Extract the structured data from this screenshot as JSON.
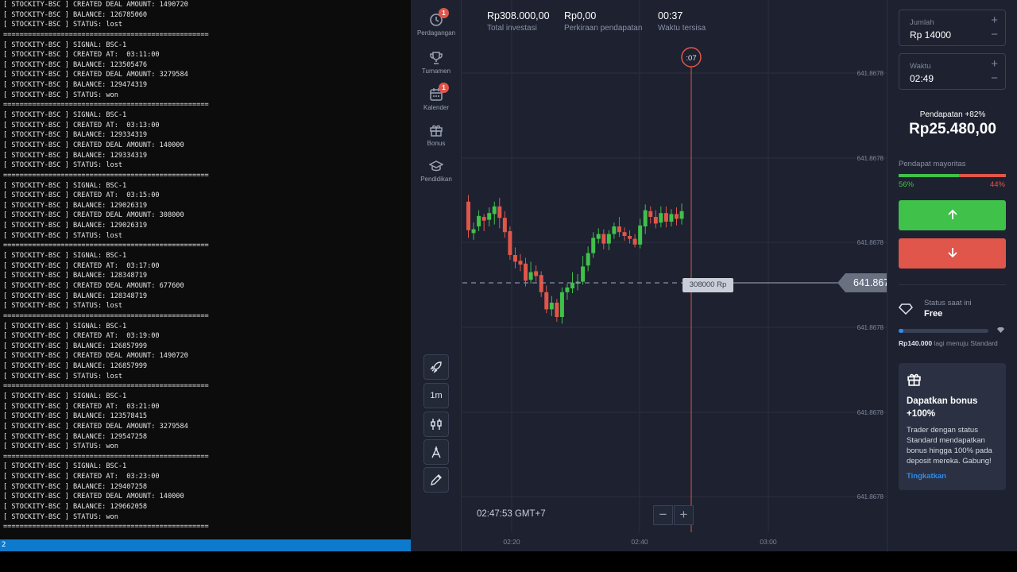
{
  "terminal": {
    "lines": [
      "[ STOCKITY-BSC ] CREATED DEAL AMOUNT: 1490720",
      "[ STOCKITY-BSC ] BALANCE: 126785060",
      "[ STOCKITY-BSC ] STATUS: lost",
      "==================================================",
      "[ STOCKITY-BSC ] SIGNAL: BSC-1",
      "[ STOCKITY-BSC ] CREATED AT:  03:11:00",
      "[ STOCKITY-BSC ] BALANCE: 123505476",
      "[ STOCKITY-BSC ] CREATED DEAL AMOUNT: 3279584",
      "[ STOCKITY-BSC ] BALANCE: 129474319",
      "[ STOCKITY-BSC ] STATUS: won",
      "==================================================",
      "[ STOCKITY-BSC ] SIGNAL: BSC-1",
      "[ STOCKITY-BSC ] CREATED AT:  03:13:00",
      "[ STOCKITY-BSC ] BALANCE: 129334319",
      "[ STOCKITY-BSC ] CREATED DEAL AMOUNT: 140000",
      "[ STOCKITY-BSC ] BALANCE: 129334319",
      "[ STOCKITY-BSC ] STATUS: lost",
      "==================================================",
      "[ STOCKITY-BSC ] SIGNAL: BSC-1",
      "[ STOCKITY-BSC ] CREATED AT:  03:15:00",
      "[ STOCKITY-BSC ] BALANCE: 129026319",
      "[ STOCKITY-BSC ] CREATED DEAL AMOUNT: 308000",
      "[ STOCKITY-BSC ] BALANCE: 129026319",
      "[ STOCKITY-BSC ] STATUS: lost",
      "==================================================",
      "[ STOCKITY-BSC ] SIGNAL: BSC-1",
      "[ STOCKITY-BSC ] CREATED AT:  03:17:00",
      "[ STOCKITY-BSC ] BALANCE: 128348719",
      "[ STOCKITY-BSC ] CREATED DEAL AMOUNT: 677600",
      "[ STOCKITY-BSC ] BALANCE: 128348719",
      "[ STOCKITY-BSC ] STATUS: lost",
      "==================================================",
      "[ STOCKITY-BSC ] SIGNAL: BSC-1",
      "[ STOCKITY-BSC ] CREATED AT:  03:19:00",
      "[ STOCKITY-BSC ] BALANCE: 126857999",
      "[ STOCKITY-BSC ] CREATED DEAL AMOUNT: 1490720",
      "[ STOCKITY-BSC ] BALANCE: 126857999",
      "[ STOCKITY-BSC ] STATUS: lost",
      "==================================================",
      "[ STOCKITY-BSC ] SIGNAL: BSC-1",
      "[ STOCKITY-BSC ] CREATED AT:  03:21:00",
      "[ STOCKITY-BSC ] BALANCE: 123578415",
      "[ STOCKITY-BSC ] CREATED DEAL AMOUNT: 3279584",
      "[ STOCKITY-BSC ] BALANCE: 129547258",
      "[ STOCKITY-BSC ] STATUS: won",
      "==================================================",
      "[ STOCKITY-BSC ] SIGNAL: BSC-1",
      "[ STOCKITY-BSC ] CREATED AT:  03:23:00",
      "[ STOCKITY-BSC ] BALANCE: 129407258",
      "[ STOCKITY-BSC ] CREATED DEAL AMOUNT: 140000",
      "[ STOCKITY-BSC ] BALANCE: 129662058",
      "[ STOCKITY-BSC ] STATUS: won",
      "=================================================="
    ],
    "status_bar_text": "2"
  },
  "sidebar": {
    "items": [
      {
        "label": "Perdagangan",
        "icon": "clock-icon",
        "badge": "1"
      },
      {
        "label": "Turnamen",
        "icon": "trophy-icon",
        "badge": ""
      },
      {
        "label": "Kalender",
        "icon": "calendar-icon",
        "badge": "1"
      },
      {
        "label": "Bonus",
        "icon": "gift-icon",
        "badge": ""
      },
      {
        "label": "Pendidikan",
        "icon": "graduation-cap-icon",
        "badge": ""
      }
    ],
    "tools": [
      {
        "name": "rocket-icon",
        "label": ""
      },
      {
        "name": "timeframe-button",
        "label": "1m"
      },
      {
        "name": "indicators-icon",
        "label": ""
      },
      {
        "name": "drawing-compass-icon",
        "label": ""
      },
      {
        "name": "pencil-icon",
        "label": ""
      }
    ]
  },
  "header": {
    "total_investment": {
      "value": "Rp308.000,00",
      "label": "Total investasi"
    },
    "estimated_income": {
      "value": "Rp0,00",
      "label": "Perkiraan pendapatan"
    },
    "time_left": {
      "value": "00:37",
      "label": "Waktu tersisa"
    }
  },
  "chart": {
    "timer_label": ":07",
    "current_price": "641.8677745150",
    "deal_tag": "308000 Rp",
    "time_readout": "02:47:53 GMT+7",
    "zoom_minus": "−",
    "zoom_plus": "+",
    "colors": {
      "up": "#3fc14a",
      "down": "#e0564a",
      "grid": "#2a2f3f",
      "timer": "#e0564a"
    }
  },
  "chart_data": {
    "type": "candlestick",
    "x_ticks": [
      "02:20",
      "02:40",
      "03:00"
    ],
    "y_ticks": [
      "641.8678",
      "641.8678",
      "641.8678",
      "641.8678",
      "641.8678",
      "641.8678"
    ],
    "candles": [
      {
        "o": 0.56,
        "c": 0.86,
        "h": 0.93,
        "l": 0.48,
        "d": "down"
      },
      {
        "o": 0.53,
        "c": 0.57,
        "h": 0.64,
        "l": 0.46,
        "d": "up"
      },
      {
        "o": 0.6,
        "c": 0.71,
        "h": 0.77,
        "l": 0.55,
        "d": "up"
      },
      {
        "o": 0.7,
        "c": 0.66,
        "h": 0.73,
        "l": 0.55,
        "d": "down"
      },
      {
        "o": 0.67,
        "c": 0.74,
        "h": 0.8,
        "l": 0.6,
        "d": "up"
      },
      {
        "o": 0.73,
        "c": 0.81,
        "h": 0.86,
        "l": 0.62,
        "d": "up"
      },
      {
        "o": 0.81,
        "c": 0.69,
        "h": 0.9,
        "l": 0.58,
        "d": "down"
      },
      {
        "o": 0.69,
        "c": 0.54,
        "h": 0.76,
        "l": 0.48,
        "d": "down"
      },
      {
        "o": 0.55,
        "c": 0.3,
        "h": 0.6,
        "l": 0.25,
        "d": "down"
      },
      {
        "o": 0.3,
        "c": 0.23,
        "h": 0.38,
        "l": 0.16,
        "d": "down"
      },
      {
        "o": 0.24,
        "c": 0.2,
        "h": 0.31,
        "l": 0.13,
        "d": "down"
      },
      {
        "o": 0.21,
        "c": 0.03,
        "h": 0.27,
        "l": -0.03,
        "d": "down"
      },
      {
        "o": 0.04,
        "c": 0.12,
        "h": 0.23,
        "l": 0.0,
        "d": "up"
      },
      {
        "o": 0.13,
        "c": 0.08,
        "h": 0.19,
        "l": 0.02,
        "d": "down"
      },
      {
        "o": 0.09,
        "c": -0.09,
        "h": 0.13,
        "l": -0.14,
        "d": "down"
      },
      {
        "o": -0.09,
        "c": -0.27,
        "h": -0.02,
        "l": -0.31,
        "d": "down"
      },
      {
        "o": -0.27,
        "c": -0.2,
        "h": -0.13,
        "l": -0.34,
        "d": "up"
      },
      {
        "o": -0.2,
        "c": -0.35,
        "h": -0.16,
        "l": -0.4,
        "d": "down"
      },
      {
        "o": -0.35,
        "c": -0.09,
        "h": -0.04,
        "l": -0.42,
        "d": "up"
      },
      {
        "o": -0.09,
        "c": -0.04,
        "h": 0.0,
        "l": -0.17,
        "d": "up"
      },
      {
        "o": -0.05,
        "c": 0.01,
        "h": 0.12,
        "l": -0.1,
        "d": "up"
      },
      {
        "o": 0.0,
        "c": 0.02,
        "h": 0.1,
        "l": -0.07,
        "d": "up"
      },
      {
        "o": 0.02,
        "c": 0.18,
        "h": 0.29,
        "l": -0.01,
        "d": "up"
      },
      {
        "o": 0.19,
        "c": 0.32,
        "h": 0.39,
        "l": 0.13,
        "d": "up"
      },
      {
        "o": 0.32,
        "c": 0.48,
        "h": 0.54,
        "l": 0.27,
        "d": "up"
      },
      {
        "o": 0.47,
        "c": 0.52,
        "h": 0.58,
        "l": 0.42,
        "d": "up"
      },
      {
        "o": 0.52,
        "c": 0.42,
        "h": 0.57,
        "l": 0.36,
        "d": "down"
      },
      {
        "o": 0.42,
        "c": 0.52,
        "h": 0.56,
        "l": 0.35,
        "d": "up"
      },
      {
        "o": 0.52,
        "c": 0.6,
        "h": 0.64,
        "l": 0.47,
        "d": "up"
      },
      {
        "o": 0.6,
        "c": 0.54,
        "h": 0.7,
        "l": 0.49,
        "d": "down"
      },
      {
        "o": 0.54,
        "c": 0.5,
        "h": 0.59,
        "l": 0.45,
        "d": "down"
      },
      {
        "o": 0.5,
        "c": 0.47,
        "h": 0.56,
        "l": 0.42,
        "d": "down"
      },
      {
        "o": 0.47,
        "c": 0.41,
        "h": 0.52,
        "l": 0.38,
        "d": "down"
      },
      {
        "o": 0.41,
        "c": 0.61,
        "h": 0.68,
        "l": 0.37,
        "d": "up"
      },
      {
        "o": 0.6,
        "c": 0.77,
        "h": 0.83,
        "l": 0.52,
        "d": "up"
      },
      {
        "o": 0.76,
        "c": 0.7,
        "h": 0.81,
        "l": 0.63,
        "d": "down"
      },
      {
        "o": 0.7,
        "c": 0.63,
        "h": 0.77,
        "l": 0.58,
        "d": "down"
      },
      {
        "o": 0.64,
        "c": 0.74,
        "h": 0.81,
        "l": 0.59,
        "d": "up"
      },
      {
        "o": 0.74,
        "c": 0.65,
        "h": 0.81,
        "l": 0.59,
        "d": "down"
      },
      {
        "o": 0.65,
        "c": 0.73,
        "h": 0.78,
        "l": 0.6,
        "d": "up"
      },
      {
        "o": 0.73,
        "c": 0.68,
        "h": 0.8,
        "l": 0.61,
        "d": "down"
      },
      {
        "o": 0.68,
        "c": 0.76,
        "h": 0.84,
        "l": 0.62,
        "d": "up"
      }
    ]
  },
  "panel": {
    "amount": {
      "label": "Jumlah",
      "value": "Rp 14000",
      "plus": "+",
      "minus": "−"
    },
    "time": {
      "label": "Waktu",
      "value": "02:49",
      "plus": "+",
      "minus": "−"
    },
    "income_label": "Pendapatan +82%",
    "income_value": "Rp25.480,00",
    "majority_label": "Pendapat mayoritas",
    "majority_up": "56%",
    "majority_down": "44%",
    "majority_up_fraction": 0.56,
    "up_button_color": "#3fc14a",
    "down_button_color": "#e0564a",
    "status_label": "Status saat ini",
    "status_value": "Free",
    "status_progress_fraction": 0.05,
    "status_note_amount": "Rp140.000",
    "status_note_text": " lagi menuju Standard",
    "bonus_title": "Dapatkan bonus +100%",
    "bonus_text": "Trader dengan status Standard mendapatkan bonus hingga 100% pada deposit mereka. Gabung!",
    "bonus_link": "Tingkatkan"
  }
}
